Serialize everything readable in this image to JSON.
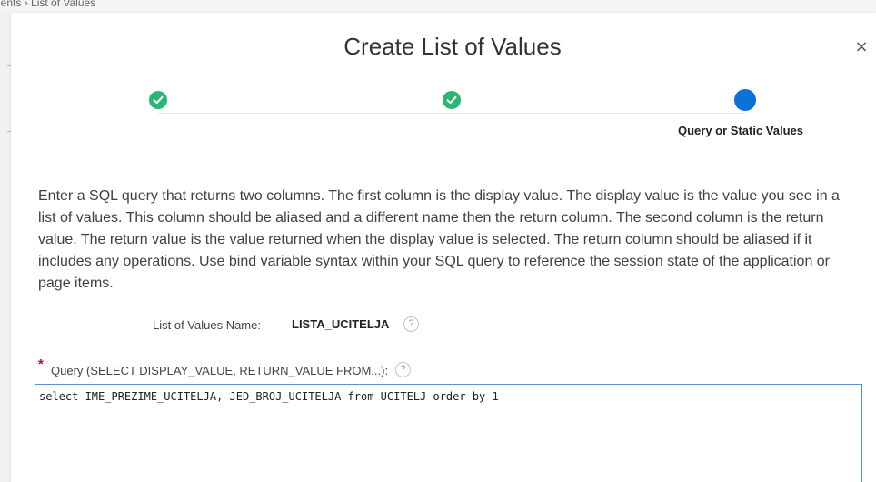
{
  "background": {
    "breadcrumb": "nents  ›  List of Values"
  },
  "dialog": {
    "title": "Create List of Values",
    "close_label": "×",
    "steps": [
      {
        "status": "complete",
        "color": "#2bb673"
      },
      {
        "status": "complete",
        "color": "#2bb673"
      },
      {
        "status": "current",
        "color": "#0a72d6",
        "label": "Query or Static Values"
      }
    ],
    "description": "Enter a SQL query that returns two columns. The first column is the display value. The display value is the value you see in a list of values. This column should be aliased and a different name then the return column. The second column is the return value. The return value is the value returned when the display value is selected. The return column should be aliased if it includes any operations. Use bind variable syntax within your SQL query to reference the session state of the application or page items.",
    "lov_name": {
      "label": "List of Values Name:",
      "value": "LISTA_UCITELJA",
      "help": "?"
    },
    "query": {
      "required_mark": "*",
      "label": "Query (SELECT DISPLAY_VALUE, RETURN_VALUE FROM...):",
      "help": "?",
      "value": "select IME_PREZIME_UCITELJA, JED_BROJ_UCITELJA from UCITELJ order by 1"
    }
  }
}
